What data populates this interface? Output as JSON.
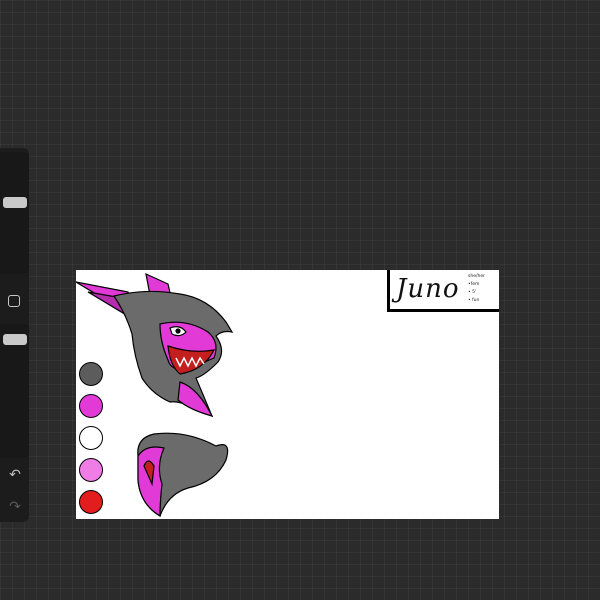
{
  "app": {
    "sidebar": {
      "undo_icon": "undo-arrow",
      "redo_icon": "redo-arrow",
      "modifier_icon": "square-modifier"
    }
  },
  "reference_sheet": {
    "character_name": "Juno",
    "notes": [
      "she/her",
      "•fem",
      "• 5'",
      "• fun"
    ],
    "palette": [
      {
        "name": "gray",
        "color": "#5c5c5c"
      },
      {
        "name": "magenta",
        "color": "#e23ad7"
      },
      {
        "name": "white",
        "color": "#ffffff"
      },
      {
        "name": "pink",
        "color": "#f07ce6"
      },
      {
        "name": "red",
        "color": "#e11d1d"
      }
    ],
    "colors": {
      "fur_gray": "#6b6b6b",
      "accent_magenta": "#e23ad7",
      "light_pink": "#f493ee",
      "line": "#000000"
    }
  }
}
